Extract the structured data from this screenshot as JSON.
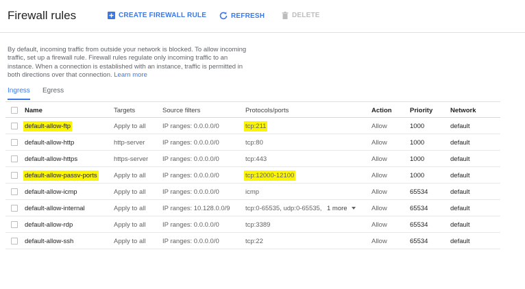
{
  "header": {
    "title": "Firewall rules",
    "create_label": "CREATE FIREWALL RULE",
    "refresh_label": "REFRESH",
    "delete_label": "DELETE"
  },
  "description": {
    "text": "By default, incoming traffic from outside your network is blocked. To allow incoming traffic, set up a firewall rule. Firewall rules regulate only incoming traffic to an instance. When a connection is established with an instance, traffic is permitted in both directions over that connection.",
    "link": "Learn more"
  },
  "tabs": [
    {
      "label": "Ingress",
      "active": true
    },
    {
      "label": "Egress",
      "active": false
    }
  ],
  "table": {
    "headers": {
      "name": "Name",
      "targets": "Targets",
      "source": "Source filters",
      "protocols": "Protocols/ports",
      "action": "Action",
      "priority": "Priority",
      "network": "Network"
    },
    "rows": [
      {
        "name": "default-allow-ftp",
        "targets": "Apply to all",
        "source": "IP ranges: 0.0.0.0/0",
        "protocols": "tcp:211",
        "action": "Allow",
        "priority": "1000",
        "network": "default"
      },
      {
        "name": "default-allow-http",
        "targets": "http-server",
        "source": "IP ranges: 0.0.0.0/0",
        "protocols": "tcp:80",
        "action": "Allow",
        "priority": "1000",
        "network": "default"
      },
      {
        "name": "default-allow-https",
        "targets": "https-server",
        "source": "IP ranges: 0.0.0.0/0",
        "protocols": "tcp:443",
        "action": "Allow",
        "priority": "1000",
        "network": "default"
      },
      {
        "name": "default-allow-passv-ports",
        "targets": "Apply to all",
        "source": "IP ranges: 0.0.0.0/0",
        "protocols": "tcp:12000-12100",
        "action": "Allow",
        "priority": "1000",
        "network": "default"
      },
      {
        "name": "default-allow-icmp",
        "targets": "Apply to all",
        "source": "IP ranges: 0.0.0.0/0",
        "protocols": "icmp",
        "action": "Allow",
        "priority": "65534",
        "network": "default"
      },
      {
        "name": "default-allow-internal",
        "targets": "Apply to all",
        "source": "IP ranges: 10.128.0.0/9",
        "protocols": "tcp:0-65535, udp:0-65535,",
        "more": "1 more",
        "action": "Allow",
        "priority": "65534",
        "network": "default"
      },
      {
        "name": "default-allow-rdp",
        "targets": "Apply to all",
        "source": "IP ranges: 0.0.0.0/0",
        "protocols": "tcp:3389",
        "action": "Allow",
        "priority": "65534",
        "network": "default"
      },
      {
        "name": "default-allow-ssh",
        "targets": "Apply to all",
        "source": "IP ranges: 0.0.0.0/0",
        "protocols": "tcp:22",
        "action": "Allow",
        "priority": "65534",
        "network": "default"
      }
    ]
  },
  "colors": {
    "accent": "#3b78e7",
    "highlight": "#fbf600",
    "disabled": "#bdbdbd"
  }
}
